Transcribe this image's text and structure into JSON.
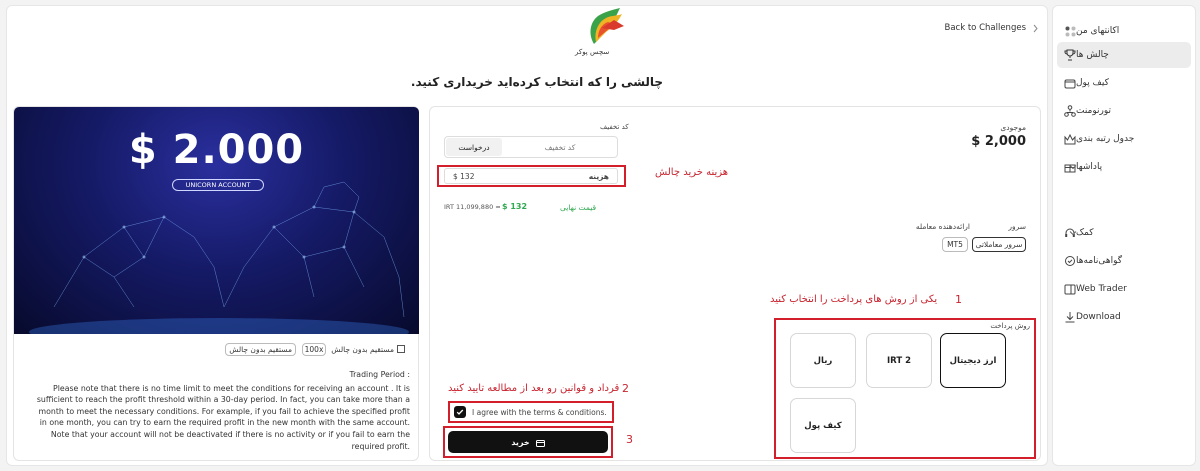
{
  "sidebar": {
    "items": [
      {
        "label": "اکانتهای من",
        "icon": "grid-icon"
      },
      {
        "label": "چالش ها",
        "icon": "trophy-icon",
        "active": true
      },
      {
        "label": "کیف پول",
        "icon": "wallet-icon"
      },
      {
        "label": "تورنومنت",
        "icon": "hierarchy-icon"
      },
      {
        "label": "جدول رتبه بندی",
        "icon": "crown-icon"
      },
      {
        "label": "پاداشها",
        "icon": "gift-icon",
        "expandable": true
      },
      {
        "label": "کمک",
        "icon": "headset-icon",
        "expandable": true
      },
      {
        "label": "گواهی‌نامه‌ها",
        "icon": "certificate-icon"
      },
      {
        "label": "Web Trader",
        "icon": "monitor-icon"
      },
      {
        "label": "Download",
        "icon": "download-icon"
      }
    ]
  },
  "header": {
    "back_label": "Back to Challenges",
    "logo_text": "سچس پوکر",
    "page_title": "چالشی را که انتخاب کرده‌اید خریداری کنید."
  },
  "product": {
    "amount": "$ 2.000",
    "account_badge": "UNICORN ACCOUNT",
    "tags": [
      "مستقیم بدون چالش",
      "100x",
      "مستقیم بدون چالش"
    ],
    "notes": [
      "Trading Period :",
      "Please note that there is no time limit to meet the conditions for receiving an account . It is sufficient to reach the profit threshold within a 30-day period. In fact, you can take more than a month to meet the necessary conditions. For example, if you fail to achieve the specified profit in one month, you can try to earn the required profit in the new month with the same account. Note that your account will not be deactivated if there is no activity or if you fail to earn the required profit."
    ]
  },
  "checkout": {
    "balance_label": "موجودی",
    "balance_value": "$ 2,000",
    "discount_label": "کد تخفیف",
    "discount_placeholder": "کد تخفیف",
    "discount_button": "درخواست",
    "cost_label": "هزینه",
    "cost_value": "$ 132",
    "final_label": "قیمت نهایی",
    "final_value": "$ 132",
    "final_irt": "IRT 11,099,880 ≈",
    "server_label": "سرور",
    "server_value": "سرور معاملاتی",
    "broker_label": "ارائه‌دهنده معامله",
    "broker_value": "MT5",
    "payment_label": "روش پرداخت",
    "payment_methods": [
      "ارز دیجیتال",
      "IRT 2",
      "ریال",
      "کیف پول"
    ],
    "terms_text": "I agree with the terms & conditions.",
    "buy_label": "خرید"
  },
  "annotations": {
    "cost_note": "هزینه خرید چالش",
    "step1_num": "1",
    "step1_text": "یکی از روش های پرداخت را انتخاب کنید",
    "step2_num": "2",
    "step2_text": "قرداد و قوانین رو بعد از مطالعه تایید کنید",
    "step3_num": "3"
  },
  "colors": {
    "accent_red": "#d21f2b",
    "green": "#2fa84f",
    "button_black": "#111111"
  }
}
